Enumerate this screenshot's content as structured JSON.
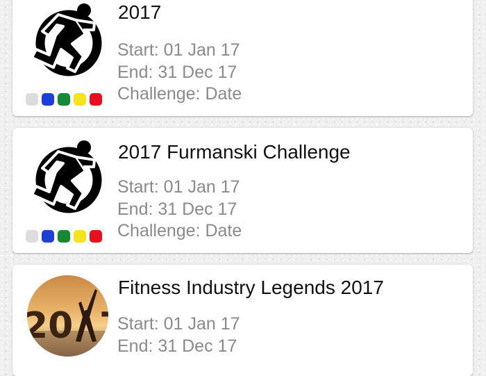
{
  "colors": {
    "background": "#efefef",
    "card": "#ffffff",
    "title_text": "#111111",
    "detail_text": "#8a8a8a",
    "legend_dots": [
      "#dcdcdc",
      "#1c3fd8",
      "#148a35",
      "#f4e41e",
      "#e8101c"
    ]
  },
  "challenges": [
    {
      "title": "2017",
      "start": "Start: 01 Jan 17",
      "end": "End: 31 Dec 17",
      "challenge": "Challenge: Date",
      "icon": "runner-logo-icon"
    },
    {
      "title": "2017 Furmanski Challenge",
      "start": "Start: 01 Jan 17",
      "end": "End: 31 Dec 17",
      "challenge": "Challenge: Date",
      "icon": "runner-logo-icon"
    },
    {
      "title": "Fitness Industry Legends 2017",
      "start": "Start: 01 Jan 17",
      "end": "End: 31 Dec 17",
      "image": "sunset-yoga-2017-photo"
    }
  ]
}
